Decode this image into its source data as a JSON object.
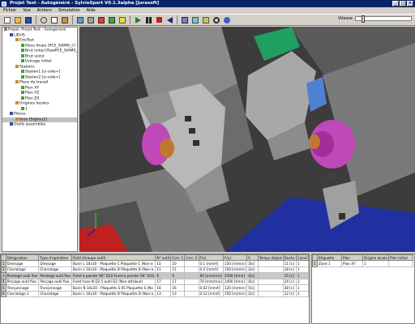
{
  "title": "Projet Test - Autogénéré - SylvieSpert V0.1.3alpha [Jurasoft]",
  "menu": [
    "Fichier",
    "Vue",
    "Actions",
    "Simulation",
    "Aide"
  ],
  "speed_label": "Vitesse",
  "speed_level": 0.1,
  "tree": [
    {
      "label": "Projet: Projet Test - Autogénéré",
      "indent": 0,
      "sel": false
    },
    {
      "label": "LIDUS",
      "indent": 1,
      "sel": false
    },
    {
      "label": "EduTest",
      "indent": 2,
      "sel": false
    },
    {
      "label": "Pièce finale [PCE_SIAMS_CI",
      "indent": 3,
      "sel": false
    },
    {
      "label": "Brut initial [RawPCE_SIAMS_C",
      "indent": 3,
      "sel": false
    },
    {
      "label": "Brut usiné",
      "indent": 3,
      "sel": false
    },
    {
      "label": "Usinage initial",
      "indent": 3,
      "sel": false
    },
    {
      "label": "Stations",
      "indent": 2,
      "sel": false
    },
    {
      "label": "Station1 [ci-vide=]",
      "indent": 3,
      "sel": false
    },
    {
      "label": "Station2 [ci-vide=]",
      "indent": 3,
      "sel": false
    },
    {
      "label": "Plans de travail",
      "indent": 2,
      "sel": false
    },
    {
      "label": "Plan XY",
      "indent": 3,
      "sel": false
    },
    {
      "label": "Plan YZ",
      "indent": 3,
      "sel": false
    },
    {
      "label": "Plan ZX",
      "indent": 3,
      "sel": false
    },
    {
      "label": "Origines locales",
      "indent": 2,
      "sel": false
    },
    {
      "label": "1",
      "indent": 3,
      "sel": false
    },
    {
      "label": "Pièces",
      "indent": 1,
      "sel": false
    },
    {
      "label": "brou [Siglieu1]",
      "indent": 2,
      "sel": true
    },
    {
      "label": "Outils assemblés",
      "indent": 1,
      "sel": false
    }
  ],
  "ops_headers": [
    "Désignation",
    "Type d'opération",
    "Outil (Groupe outil)",
    "N° outil",
    "Corr. 1",
    "Corr. 2",
    "F(z)",
    "F(y)",
    "S",
    "Temps déplat",
    "Durée",
    "Canal"
  ],
  "ops_rows": [
    {
      "no": "1",
      "cells": [
        "Dressage",
        "Dressage",
        "Burin L 10x10 - Plaquette C Plaquette C (Non-a",
        "10",
        "10",
        "",
        "0.1 [mm/t]",
        "150 [m/min]",
        "3[s]",
        "",
        "11 [s]",
        "1"
      ],
      "hl": false
    },
    {
      "no": "2",
      "cells": [
        "Chariotage",
        "Chariotage",
        "Burin L 10x10 - Plaquette D Plaquette D (Non-a",
        "11",
        "11",
        "",
        "0.2 [mm/t]",
        "150 [m/min]",
        "2[s]",
        "",
        "18 [s]",
        "1"
      ],
      "hl": false
    },
    {
      "no": "3",
      "cells": [
        "Pointage outil fixe",
        "Pointage outil fixe",
        "Foret à pointer 90° D10 Foret à pointer 90° D10",
        "6",
        "6",
        "",
        "60 [mm/min]",
        "2500 [t/mn]",
        "2[s]",
        "",
        "15 [s]",
        "1"
      ],
      "hl": true
    },
    {
      "no": "4",
      "cells": [
        "Perçage outil fixe",
        "Perçage outil fixe",
        "Foret hsse N D2.5 outil D2 (Non-attribué)",
        "17",
        "17",
        "",
        "70 [mm/min]",
        "2400 [t/mn]",
        "4[s]",
        "",
        "24 [s]",
        "1"
      ],
      "hl": false
    },
    {
      "no": "5",
      "cells": [
        "Tronçonnage",
        "Tronçonnage",
        "Burin N 10x10 - Plaquette S 05 Plaquette S (No",
        "16",
        "16",
        "",
        "0.02 [mm/t]",
        "120 [m/min]",
        "5[s]",
        "",
        "38 [s]",
        "1"
      ],
      "hl": false
    },
    {
      "no": "6",
      "cells": [
        "Chariotage 2",
        "Chariotage",
        "Burin L 10x10 - Plaquette D Plaquette D (Non-a",
        "13",
        "13",
        "",
        "0.12 [mm/t]",
        "150 [m/min]",
        "2[s]",
        "",
        "12 [s]",
        "1"
      ],
      "hl": false
    }
  ],
  "side_headers": [
    "Etiquette",
    "Plan",
    "Origine locale",
    "Plan initial"
  ],
  "side_rows": [
    {
      "no": "1",
      "cells": [
        "Zone 1",
        "Plan XY",
        "1",
        ""
      ]
    }
  ],
  "colors": {
    "titlebar": "#0a246a",
    "viewport": "#3c3c3c",
    "accent_magenta": "#c040c0",
    "part_gray": "#b8b8b8"
  }
}
